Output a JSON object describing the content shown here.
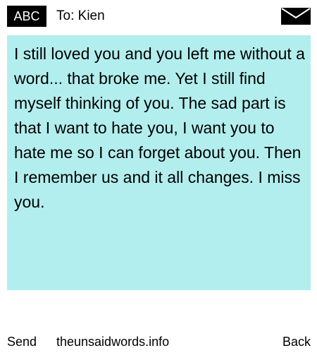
{
  "header": {
    "input_mode": "ABC",
    "to_label": "To:",
    "recipient": "Kien",
    "icon": "envelope-icon"
  },
  "message": {
    "text": "I still loved you and you left me without a word... that broke me. Yet I still find myself thinking of you. The sad part is that I want to hate you, I want you to hate me so I can forget about you. Then I remember us and it all changes. I miss you."
  },
  "footer": {
    "send_label": "Send",
    "site": "theunsaidwords.info",
    "back_label": "Back"
  },
  "colors": {
    "message_background": "#b3eeee",
    "input_mode_background": "#000000"
  }
}
